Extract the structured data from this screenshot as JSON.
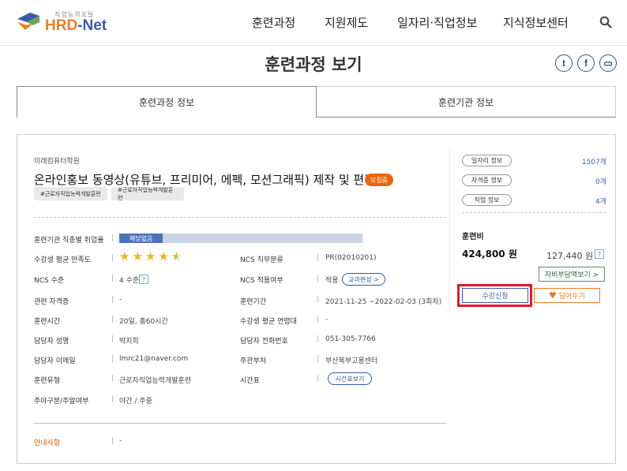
{
  "header": {
    "logo_small": "직업능력포털",
    "logo_hrd": "HRD",
    "logo_net": "-Net",
    "nav": [
      "훈련과정",
      "지원제도",
      "일자리·직업정보",
      "지식정보센터"
    ]
  },
  "page_title": "훈련과정 보기",
  "share": {
    "twitter": "t",
    "facebook": "f",
    "board": "▭"
  },
  "tabs": [
    "훈련과정 정보",
    "훈련기관 정보"
  ],
  "course": {
    "academy": "미래컴퓨터학원",
    "title": "온라인홍보 동영상(유튜브, 프리미어, 에펙, 모션그래픽) 제작 및 편집",
    "status_badge": "모집중",
    "tags": [
      "#근로자직업능력개발훈련",
      "#근로자직업능력개발훈련"
    ]
  },
  "details": {
    "employment_label": "훈련기관 직종별 취업률",
    "employment_value": "해당없음",
    "employment_fill_fraction": 0.18,
    "satisfaction_label": "수강생 평균 만족도",
    "satisfaction_stars": 4.5,
    "ncs_category_label": "NCS 직무분류",
    "ncs_category_value": "PR(02010201)",
    "ncs_level_label": "NCS 수준",
    "ncs_level_value": "4 수준",
    "ncs_applied_label": "NCS 적용여부",
    "ncs_applied_value": "적용",
    "curriculum_btn": "교과편성 >",
    "cert_label": "관련 자격증",
    "cert_value": "-",
    "period_label": "훈련기간",
    "period_value": "2021-11-25 ~2022-02-03 (3회차)",
    "hours_label": "훈련시간",
    "hours_value": "20일, 총60시간",
    "age_label": "수강생 평균 연령대",
    "age_value": "-",
    "manager_label": "담당자 성명",
    "manager_value": "박지희",
    "phone_label": "담당자 전화번호",
    "phone_value": "051-305-7766",
    "email_label": "담당자 이메일",
    "email_value": "lmrc21@naver.com",
    "dept_label": "주관부처",
    "dept_value": "부산북부고용센터",
    "type_label": "훈련유형",
    "type_value": "근로자직업능력개발훈련",
    "schedule_label": "시간표",
    "schedule_btn": "시간표보기",
    "dayweek_label": "주야구분/주말여부",
    "dayweek_value": "야간 / 주중",
    "notice_label": "안내사항",
    "notice_value": "-"
  },
  "side": {
    "job_info": "일자리 정보",
    "job_count": "1507개",
    "cert_info": "자격증 정보",
    "cert_count": "0개",
    "occ_info": "직업 정보",
    "occ_count": "4개",
    "fee_label": "훈련비",
    "fee_total": "424,800 원",
    "fee_self": "127,440 원",
    "self_btn": "자비부담액보기 >",
    "apply_btn": "수강신청",
    "wish_btn": "담아두기"
  },
  "colors": {
    "brand_orange": "#e67e22",
    "brand_blue": "#3a5aa9",
    "highlight_red": "#e01a24"
  }
}
